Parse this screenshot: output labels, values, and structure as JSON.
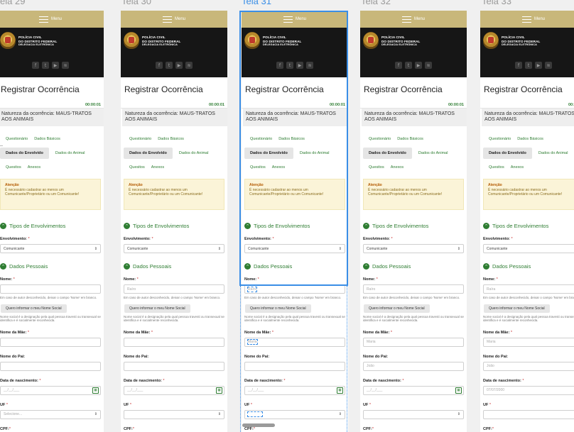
{
  "screens": [
    {
      "title": "Tela 29",
      "title_visible": "ela 29",
      "active": false,
      "name": "",
      "mae": "",
      "pai": "",
      "nascimento": "__/__/___",
      "uf": "Selecione...",
      "highlight": false
    },
    {
      "title": "Tela 30",
      "title_visible": "Tela 30",
      "active": false,
      "name": "Raíro",
      "mae": "",
      "pai": "",
      "nascimento": "__/__/___",
      "uf": "",
      "highlight": false
    },
    {
      "title": "Tela 31",
      "title_visible": "Tela 31",
      "active": true,
      "name": "Raíro",
      "mae": "Maria",
      "pai": "",
      "nascimento": "__/__/___",
      "uf": "",
      "highlight": true
    },
    {
      "title": "Tela 32",
      "title_visible": "Tela 32",
      "active": false,
      "name": "Raíro",
      "mae": "Maria",
      "pai": "João",
      "nascimento": "__/__/___",
      "uf": "",
      "highlight": false
    },
    {
      "title": "Tela 33",
      "title_visible": "Tela 33",
      "active": false,
      "name": "Raíra",
      "mae": "Maria",
      "pai": "João",
      "nascimento": "07/07/2000",
      "uf": "",
      "highlight": false
    }
  ],
  "common": {
    "menu_label": "Menu",
    "org_line1": "POLÍCIA CIVIL",
    "org_line2": "DO DISTRITO FEDERAL",
    "org_line3": "DELEGACIA ELETRÔNICA",
    "social_icons": [
      "facebook-icon",
      "twitter-icon",
      "youtube-icon",
      "rss-icon"
    ],
    "social_glyphs": [
      "f",
      "t",
      "▶",
      "≋"
    ],
    "page_title": "Registrar Ocorrência",
    "timer": "00:00:01",
    "natureza": "Natureza da ocorrência: MAUS-TRATOS AOS ANIMAIS",
    "tabs_row1": [
      "Questionário",
      "Dados Básicos"
    ],
    "tabs_row2": [
      "Dados do Envolvido",
      "Dados do Animal"
    ],
    "tabs_row3": [
      "Quesitos",
      "Anexos"
    ],
    "alert_title": "Atenção",
    "alert_text": "É necessário cadastrar ao menos um Comunicante/Proprietário ou um Comunicante!",
    "section_tipos": "Tipos de Envolvimentos",
    "envolvimento_label": "Envolvimento:",
    "envolvimento_value": "Comunicante",
    "section_pessoais": "Dados Pessoais",
    "nome_label": "Nome:",
    "nome_hint": "Em caso de autor desconhecido, deixar o campo 'Nome' em branco.",
    "social_btn": "Quero informar o meu Nome Social",
    "social_hint": "Nome social é a designação pela qual pessoa travesti ou transexual se identifica e é socialmente reconhecida.",
    "mae_label": "Nome da Mãe:",
    "pai_label": "Nome do Pai:",
    "nasc_label": "Data de nascimento:",
    "uf_label": "UF",
    "cpf_label": "CPF:",
    "cpf_placeholder": "___.___.___-__",
    "required_mark": "*",
    "accent": "#2e7d32",
    "menu_color": "#c8b77a",
    "selection_color": "#3a8ee6"
  }
}
